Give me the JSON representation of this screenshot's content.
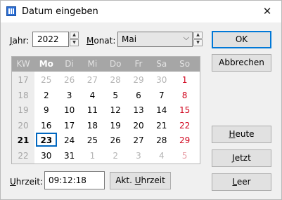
{
  "window": {
    "title": "Datum eingeben",
    "close_glyph": "✕"
  },
  "year": {
    "label_prefix": "J",
    "label_rest": "ahr:",
    "value": "2022"
  },
  "month": {
    "label_prefix": "M",
    "label_rest": "onat:",
    "value": "Mai"
  },
  "calendar": {
    "headers": [
      "KW",
      "Mo",
      "Di",
      "Mi",
      "Do",
      "Fr",
      "Sa",
      "So"
    ],
    "weeks": [
      {
        "kw": "17",
        "days": [
          "25",
          "26",
          "27",
          "28",
          "29",
          "30",
          "1"
        ]
      },
      {
        "kw": "18",
        "days": [
          "2",
          "3",
          "4",
          "5",
          "6",
          "7",
          "8"
        ]
      },
      {
        "kw": "19",
        "days": [
          "9",
          "10",
          "11",
          "12",
          "13",
          "14",
          "15"
        ]
      },
      {
        "kw": "20",
        "days": [
          "16",
          "17",
          "18",
          "19",
          "20",
          "21",
          "22"
        ]
      },
      {
        "kw": "21",
        "days": [
          "23",
          "24",
          "25",
          "26",
          "27",
          "28",
          "29"
        ]
      },
      {
        "kw": "22",
        "days": [
          "30",
          "31",
          "1",
          "2",
          "3",
          "4",
          "5"
        ]
      }
    ],
    "selected_day": "23",
    "sunday_color": "#d0021b",
    "selection_color": "#0067c0"
  },
  "time": {
    "label_prefix": "U",
    "label_rest": "hrzeit:",
    "value": "09:12:18"
  },
  "buttons": {
    "akt_uhrzeit_pre": "Akt. ",
    "akt_uhrzeit_u": "U",
    "akt_uhrzeit_rest": "hrzeit",
    "ok": "OK",
    "abbrechen": "Abbrechen",
    "heute_u": "H",
    "heute_rest": "eute",
    "jetzt_u": "J",
    "jetzt_rest": "etzt",
    "leer_u": "L",
    "leer_rest": "eer"
  },
  "icons": {
    "app": "calendar-app-icon",
    "close": "close-icon",
    "spin_up": "spin-up-icon",
    "spin_down": "spin-down-icon",
    "dropdown": "chevron-down-icon"
  }
}
